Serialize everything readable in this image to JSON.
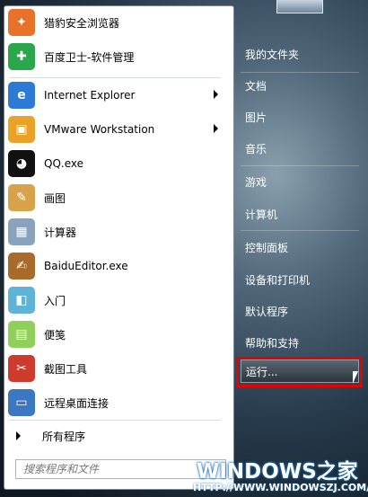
{
  "programs": [
    {
      "label": "猎豹安全浏览器",
      "icon": "cheetah-browser-icon",
      "color": "#e8722a"
    },
    {
      "label": "百度卫士-软件管理",
      "icon": "baidu-guard-icon",
      "color": "#2aa64b"
    },
    {
      "label": "Internet Explorer",
      "icon": "internet-explorer-icon",
      "color": "#2d7ad6",
      "submenu": true
    },
    {
      "label": "VMware Workstation",
      "icon": "vmware-icon",
      "color": "#e9a127",
      "submenu": true
    },
    {
      "label": "QQ.exe",
      "icon": "qq-penguin-icon",
      "color": "#111111"
    },
    {
      "label": "画图",
      "icon": "paint-palette-icon",
      "color": "#d9a24a"
    },
    {
      "label": "计算器",
      "icon": "calculator-icon",
      "color": "#8aa3bd"
    },
    {
      "label": "BaiduEditor.exe",
      "icon": "baidu-editor-icon",
      "color": "#a86b2c"
    },
    {
      "label": "入门",
      "icon": "getting-started-icon",
      "color": "#5fb2d8"
    },
    {
      "label": "便笺",
      "icon": "sticky-notes-icon",
      "color": "#8fcf5a"
    },
    {
      "label": "截图工具",
      "icon": "snipping-tool-icon",
      "color": "#cc3b2c"
    },
    {
      "label": "远程桌面连接",
      "icon": "remote-desktop-icon",
      "color": "#3a78c4"
    }
  ],
  "all_programs": "所有程序",
  "search": {
    "placeholder": "搜索程序和文件"
  },
  "right_pane": {
    "items": [
      "我的文件夹",
      "文档",
      "图片",
      "音乐",
      "游戏",
      "计算机",
      "控制面板",
      "设备和打印机",
      "默认程序",
      "帮助和支持"
    ],
    "run": "运行..."
  },
  "watermark": {
    "main": "WINDOWS之家",
    "sub": "HTTP://WWW.WINDOWSZJ.COM/"
  }
}
